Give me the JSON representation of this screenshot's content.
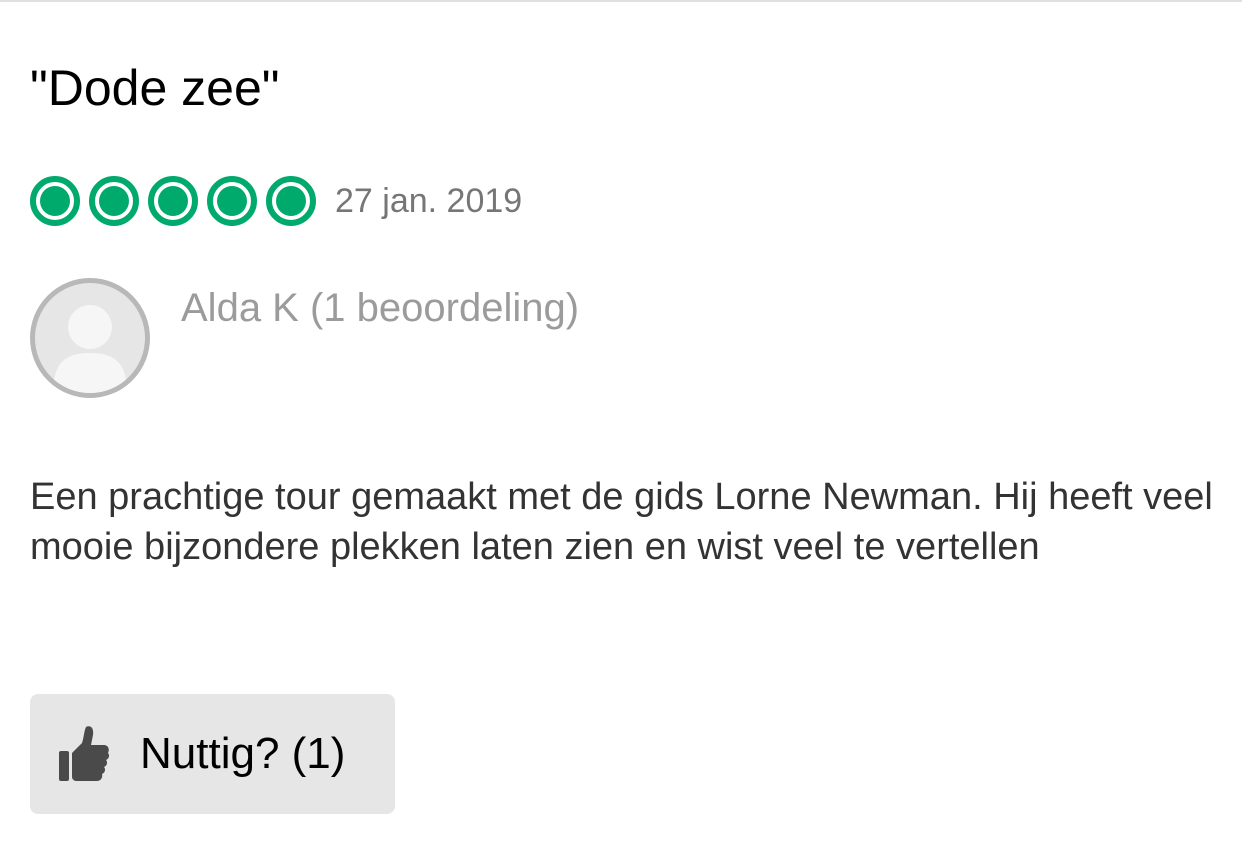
{
  "review": {
    "title": "\"Dode zee\"",
    "rating": {
      "value": 5,
      "max": 5,
      "color": "#00aa6c",
      "icon": "rating-bubble-icon"
    },
    "date": "27 jan. 2019",
    "reviewer": {
      "display": "Alda K (1 beoordeling)",
      "avatar_icon": "default-user-avatar-icon"
    },
    "body": "Een prachtige tour gemaakt met de gids Lorne Newman. Hij heeft veel mooie bijzondere plekken laten zien en wist veel te vertellen",
    "helpful_button": {
      "icon": "thumbs-up-icon",
      "label": "Nuttig? (1)"
    }
  }
}
